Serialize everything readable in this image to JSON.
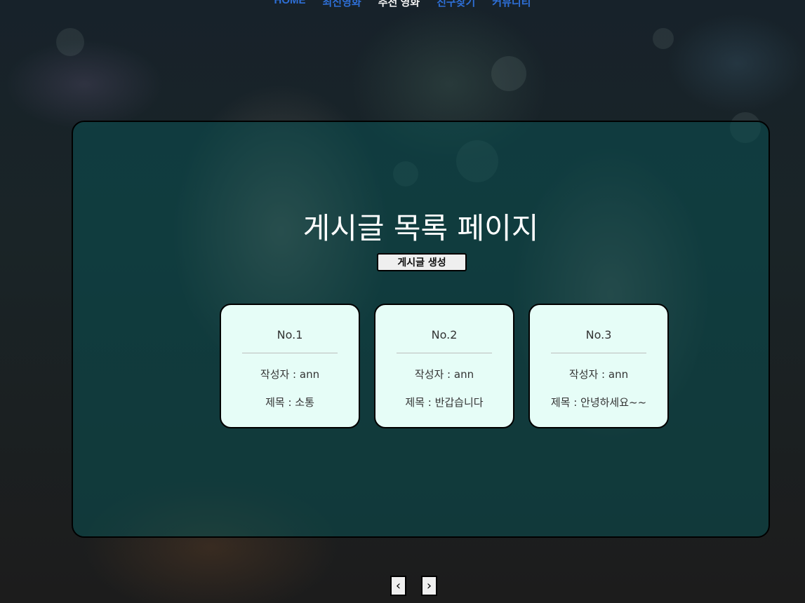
{
  "nav": {
    "items": [
      {
        "label": "HOME",
        "active": false
      },
      {
        "label": "최신영화",
        "active": false
      },
      {
        "label": "추천 영화",
        "active": true
      },
      {
        "label": "친구찾기",
        "active": false
      },
      {
        "label": "커뮤니티",
        "active": false
      }
    ]
  },
  "page": {
    "title": "게시글 목록 페이지",
    "create_button": "게시글 생성"
  },
  "posts": [
    {
      "no": "No.1",
      "author": "작성자 : ann",
      "title": "제목 : 소통"
    },
    {
      "no": "No.2",
      "author": "작성자 : ann",
      "title": "제목 : 반갑습니다"
    },
    {
      "no": "No.3",
      "author": "작성자 : ann",
      "title": "제목 : 안녕하세요~~"
    }
  ],
  "pagination": {
    "prev_icon": "‹",
    "next_icon": "›"
  },
  "colors": {
    "nav_link": "#2e6fd6",
    "nav_active": "#f2f2f2",
    "panel_bg": "#0a5052",
    "card_bg": "#e6fdf7"
  }
}
